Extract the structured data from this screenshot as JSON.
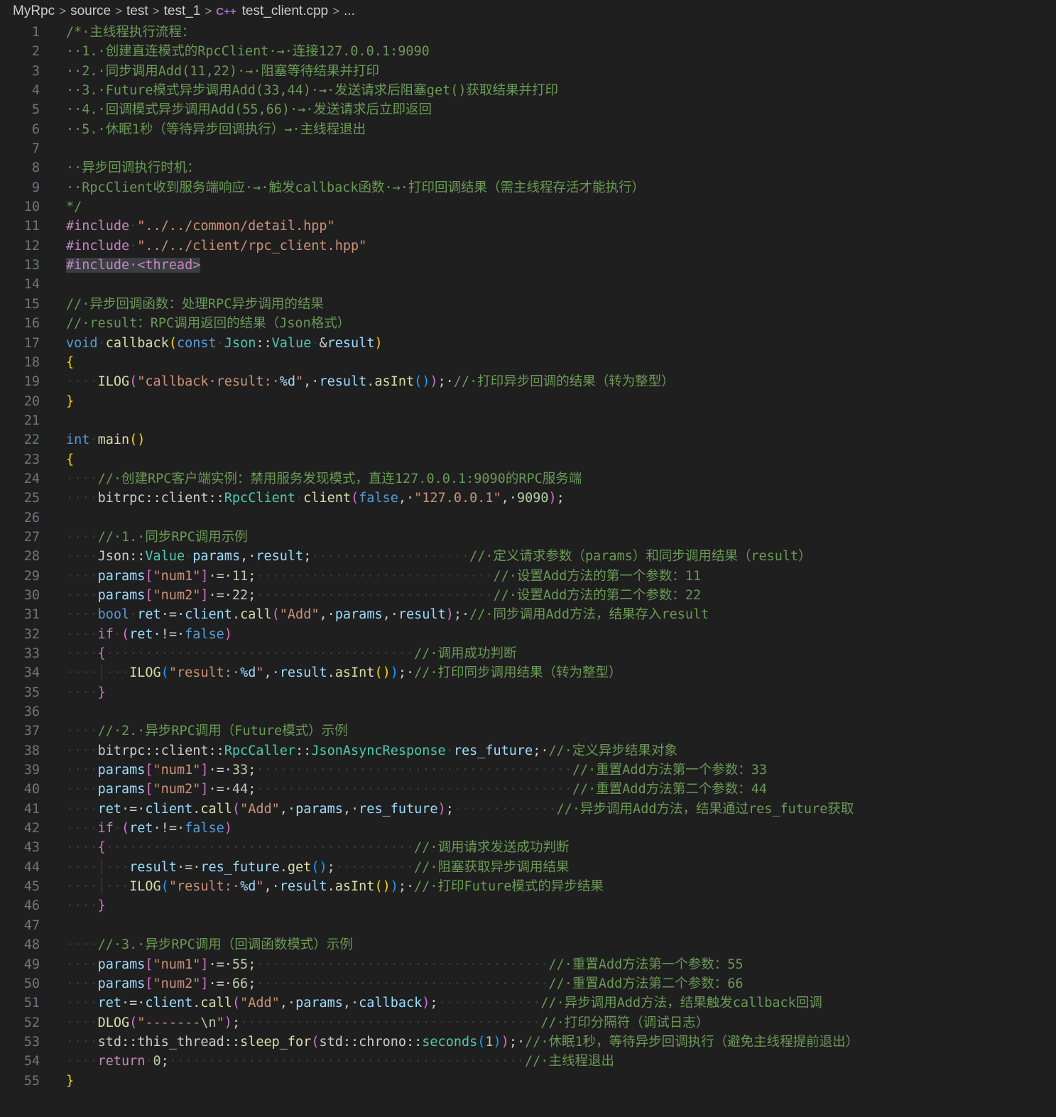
{
  "breadcrumb": {
    "items": [
      "MyRpc",
      "source",
      "test",
      "test_1"
    ],
    "file_icon": "C++",
    "file": "test_client.cpp",
    "ellipsis": "..."
  },
  "code_lines": [
    [
      [
        "/*·主线程执行流程：",
        "cmt"
      ]
    ],
    [
      [
        "··1.·创建直连模式的RpcClient·→·连接127.0.0.1:9090",
        "cmt"
      ]
    ],
    [
      [
        "··2.·同步调用Add(11,22)·→·阻塞等待结果并打印",
        "cmt"
      ]
    ],
    [
      [
        "··3.·Future模式异步调用Add(33,44)·→·发送请求后阻塞get()获取结果并打印",
        "cmt"
      ]
    ],
    [
      [
        "··4.·回调模式异步调用Add(55,66)·→·发送请求后立即返回",
        "cmt"
      ]
    ],
    [
      [
        "··5.·休眠1秒（等待异步回调执行）→·主线程退出",
        "cmt"
      ]
    ],
    [],
    [
      [
        "··异步回调执行时机：",
        "cmt"
      ]
    ],
    [
      [
        "··RpcClient收到服务端响应·→·触发callback函数·→·打印回调结果（需主线程存活才能执行）",
        "cmt"
      ]
    ],
    [
      [
        "*/",
        "cmt"
      ]
    ],
    [
      [
        "#include",
        "ctl"
      ],
      [
        "·",
        "ws"
      ],
      [
        "\"../../common/detail.hpp\"",
        "str"
      ]
    ],
    [
      [
        "#include",
        "ctl"
      ],
      [
        "·",
        "ws"
      ],
      [
        "\"../../client/rpc_client.hpp\"",
        "str"
      ]
    ],
    [
      [
        "#include·<thread>",
        "hl-str"
      ]
    ],
    [],
    [
      [
        "//·异步回调函数：处理RPC异步调用的结果",
        "cmt"
      ]
    ],
    [
      [
        "//·result：RPC调用返回的结果（Json格式）",
        "cmt"
      ]
    ],
    [
      [
        "void",
        "kw"
      ],
      [
        "·",
        "ws"
      ],
      [
        "callback",
        "fn"
      ],
      [
        "(",
        "br1"
      ],
      [
        "const",
        "kw"
      ],
      [
        "·",
        "ws"
      ],
      [
        "Json",
        "ty"
      ],
      [
        "::",
        "plain"
      ],
      [
        "Value",
        "ty"
      ],
      [
        "·",
        "ws"
      ],
      [
        "&",
        "plain"
      ],
      [
        "result",
        "var"
      ],
      [
        ")",
        "br1"
      ]
    ],
    [
      [
        "{",
        "br1"
      ]
    ],
    [
      [
        "····",
        "ws"
      ],
      [
        "ILOG",
        "fn"
      ],
      [
        "(",
        "br2"
      ],
      [
        "\"callback·result:·",
        "str"
      ],
      [
        "%d",
        "var"
      ],
      [
        "\"",
        "str"
      ],
      [
        ",·",
        "plain"
      ],
      [
        "result",
        "var"
      ],
      [
        ".",
        "plain"
      ],
      [
        "asInt",
        "fn"
      ],
      [
        "()",
        "br3"
      ],
      [
        ")",
        "br2"
      ],
      [
        ";·",
        "plain"
      ],
      [
        "//·打印异步回调的结果（转为整型）",
        "cmt"
      ]
    ],
    [
      [
        "}",
        "br1"
      ]
    ],
    [],
    [
      [
        "int",
        "kw"
      ],
      [
        "·",
        "ws"
      ],
      [
        "main",
        "fn"
      ],
      [
        "()",
        "br1"
      ]
    ],
    [
      [
        "{",
        "br1"
      ]
    ],
    [
      [
        "····",
        "ws"
      ],
      [
        "//·创建RPC客户端实例：禁用服务发现模式，直连127.0.0.1:9090的RPC服务端",
        "cmt"
      ]
    ],
    [
      [
        "····",
        "ws"
      ],
      [
        "bitrpc",
        "plain"
      ],
      [
        "::",
        "plain"
      ],
      [
        "client",
        "plain"
      ],
      [
        "::",
        "plain"
      ],
      [
        "RpcClient",
        "ty"
      ],
      [
        "·",
        "ws"
      ],
      [
        "client",
        "fn"
      ],
      [
        "(",
        "br2"
      ],
      [
        "false",
        "kw"
      ],
      [
        ",·",
        "plain"
      ],
      [
        "\"127.0.0.1\"",
        "str"
      ],
      [
        ",·",
        "plain"
      ],
      [
        "9090",
        "num"
      ],
      [
        ")",
        "br2"
      ],
      [
        ";",
        "plain"
      ]
    ],
    [],
    [
      [
        "····",
        "ws"
      ],
      [
        "//·1.·同步RPC调用示例",
        "cmt"
      ]
    ],
    [
      [
        "····",
        "ws"
      ],
      [
        "Json",
        "plain"
      ],
      [
        "::",
        "plain"
      ],
      [
        "Value",
        "ty"
      ],
      [
        "·",
        "ws"
      ],
      [
        "params",
        "var"
      ],
      [
        ",·",
        "plain"
      ],
      [
        "result",
        "var"
      ],
      [
        ";",
        "plain"
      ],
      [
        "····················",
        "ws"
      ],
      [
        "//·定义请求参数（params）和同步调用结果（result）",
        "cmt"
      ]
    ],
    [
      [
        "····",
        "ws"
      ],
      [
        "params",
        "var"
      ],
      [
        "[",
        "br2"
      ],
      [
        "\"num1\"",
        "str"
      ],
      [
        "]",
        "br2"
      ],
      [
        "·=·",
        "plain"
      ],
      [
        "11",
        "num"
      ],
      [
        ";",
        "plain"
      ],
      [
        "······························",
        "ws"
      ],
      [
        "//·设置Add方法的第一个参数：11",
        "cmt"
      ]
    ],
    [
      [
        "····",
        "ws"
      ],
      [
        "params",
        "var"
      ],
      [
        "[",
        "br2"
      ],
      [
        "\"num2\"",
        "str"
      ],
      [
        "]",
        "br2"
      ],
      [
        "·=·",
        "plain"
      ],
      [
        "22",
        "num"
      ],
      [
        ";",
        "plain"
      ],
      [
        "······························",
        "ws"
      ],
      [
        "//·设置Add方法的第二个参数：22",
        "cmt"
      ]
    ],
    [
      [
        "····",
        "ws"
      ],
      [
        "bool",
        "kw"
      ],
      [
        "·",
        "ws"
      ],
      [
        "ret",
        "var"
      ],
      [
        "·=·",
        "plain"
      ],
      [
        "client",
        "var"
      ],
      [
        ".",
        "plain"
      ],
      [
        "call",
        "fn"
      ],
      [
        "(",
        "br2"
      ],
      [
        "\"Add\"",
        "str"
      ],
      [
        ",·",
        "plain"
      ],
      [
        "params",
        "var"
      ],
      [
        ",·",
        "plain"
      ],
      [
        "result",
        "var"
      ],
      [
        ")",
        "br2"
      ],
      [
        ";·",
        "plain"
      ],
      [
        "//·同步调用Add方法，结果存入result",
        "cmt"
      ]
    ],
    [
      [
        "····",
        "ws"
      ],
      [
        "if",
        "ctl"
      ],
      [
        "·",
        "ws"
      ],
      [
        "(",
        "br2"
      ],
      [
        "ret",
        "var"
      ],
      [
        "·!=·",
        "plain"
      ],
      [
        "false",
        "kw"
      ],
      [
        ")",
        "br2"
      ]
    ],
    [
      [
        "····",
        "ws"
      ],
      [
        "{",
        "br2"
      ],
      [
        "·······································",
        "ws"
      ],
      [
        "//·调用成功判断",
        "cmt"
      ]
    ],
    [
      [
        "····│···",
        "ws"
      ],
      [
        "ILOG",
        "fn"
      ],
      [
        "(",
        "br3"
      ],
      [
        "\"result:·",
        "str"
      ],
      [
        "%d",
        "var"
      ],
      [
        "\"",
        "str"
      ],
      [
        ",·",
        "plain"
      ],
      [
        "result",
        "var"
      ],
      [
        ".",
        "plain"
      ],
      [
        "asInt",
        "fn"
      ],
      [
        "(",
        "br1"
      ],
      [
        ")",
        "br1"
      ],
      [
        ")",
        "br3"
      ],
      [
        ";·",
        "plain"
      ],
      [
        "//·打印同步调用结果（转为整型）",
        "cmt"
      ]
    ],
    [
      [
        "····",
        "ws"
      ],
      [
        "}",
        "br2"
      ]
    ],
    [],
    [
      [
        "····",
        "ws"
      ],
      [
        "//·2.·异步RPC调用（Future模式）示例",
        "cmt"
      ]
    ],
    [
      [
        "····",
        "ws"
      ],
      [
        "bitrpc",
        "plain"
      ],
      [
        "::",
        "plain"
      ],
      [
        "client",
        "plain"
      ],
      [
        "::",
        "plain"
      ],
      [
        "RpcCaller",
        "ty"
      ],
      [
        "::",
        "plain"
      ],
      [
        "JsonAsyncResponse",
        "ty"
      ],
      [
        "·",
        "ws"
      ],
      [
        "res_future",
        "var"
      ],
      [
        ";·",
        "plain"
      ],
      [
        "//·定义异步结果对象",
        "cmt"
      ]
    ],
    [
      [
        "····",
        "ws"
      ],
      [
        "params",
        "var"
      ],
      [
        "[",
        "br2"
      ],
      [
        "\"num1\"",
        "str"
      ],
      [
        "]",
        "br2"
      ],
      [
        "·=·",
        "plain"
      ],
      [
        "33",
        "num"
      ],
      [
        ";",
        "plain"
      ],
      [
        "········································",
        "ws"
      ],
      [
        "//·重置Add方法第一个参数：33",
        "cmt"
      ]
    ],
    [
      [
        "····",
        "ws"
      ],
      [
        "params",
        "var"
      ],
      [
        "[",
        "br2"
      ],
      [
        "\"num2\"",
        "str"
      ],
      [
        "]",
        "br2"
      ],
      [
        "·=·",
        "plain"
      ],
      [
        "44",
        "num"
      ],
      [
        ";",
        "plain"
      ],
      [
        "········································",
        "ws"
      ],
      [
        "//·重置Add方法第二个参数：44",
        "cmt"
      ]
    ],
    [
      [
        "····",
        "ws"
      ],
      [
        "ret",
        "var"
      ],
      [
        "·=·",
        "plain"
      ],
      [
        "client",
        "var"
      ],
      [
        ".",
        "plain"
      ],
      [
        "call",
        "fn"
      ],
      [
        "(",
        "br2"
      ],
      [
        "\"Add\"",
        "str"
      ],
      [
        ",·",
        "plain"
      ],
      [
        "params",
        "var"
      ],
      [
        ",·",
        "plain"
      ],
      [
        "res_future",
        "var"
      ],
      [
        ")",
        "br2"
      ],
      [
        ";",
        "plain"
      ],
      [
        "·············",
        "ws"
      ],
      [
        "//·异步调用Add方法，结果通过res_future获取",
        "cmt"
      ]
    ],
    [
      [
        "····",
        "ws"
      ],
      [
        "if",
        "ctl"
      ],
      [
        "·",
        "ws"
      ],
      [
        "(",
        "br2"
      ],
      [
        "ret",
        "var"
      ],
      [
        "·!=·",
        "plain"
      ],
      [
        "false",
        "kw"
      ],
      [
        ")",
        "br2"
      ]
    ],
    [
      [
        "····",
        "ws"
      ],
      [
        "{",
        "br2"
      ],
      [
        "·······································",
        "ws"
      ],
      [
        "//·调用请求发送成功判断",
        "cmt"
      ]
    ],
    [
      [
        "····│···",
        "ws"
      ],
      [
        "result",
        "var"
      ],
      [
        "·=·",
        "plain"
      ],
      [
        "res_future",
        "var"
      ],
      [
        ".",
        "plain"
      ],
      [
        "get",
        "fn"
      ],
      [
        "()",
        "br3"
      ],
      [
        ";",
        "plain"
      ],
      [
        "··········",
        "ws"
      ],
      [
        "//·阻塞获取异步调用结果",
        "cmt"
      ]
    ],
    [
      [
        "····│···",
        "ws"
      ],
      [
        "ILOG",
        "fn"
      ],
      [
        "(",
        "br3"
      ],
      [
        "\"result:·",
        "str"
      ],
      [
        "%d",
        "var"
      ],
      [
        "\"",
        "str"
      ],
      [
        ",·",
        "plain"
      ],
      [
        "result",
        "var"
      ],
      [
        ".",
        "plain"
      ],
      [
        "asInt",
        "fn"
      ],
      [
        "(",
        "br1"
      ],
      [
        ")",
        "br1"
      ],
      [
        ")",
        "br3"
      ],
      [
        ";·",
        "plain"
      ],
      [
        "//·打印Future模式的异步结果",
        "cmt"
      ]
    ],
    [
      [
        "····",
        "ws"
      ],
      [
        "}",
        "br2"
      ]
    ],
    [],
    [
      [
        "····",
        "ws"
      ],
      [
        "//·3.·异步RPC调用（回调函数模式）示例",
        "cmt"
      ]
    ],
    [
      [
        "····",
        "ws"
      ],
      [
        "params",
        "var"
      ],
      [
        "[",
        "br2"
      ],
      [
        "\"num1\"",
        "str"
      ],
      [
        "]",
        "br2"
      ],
      [
        "·=·",
        "plain"
      ],
      [
        "55",
        "num"
      ],
      [
        ";",
        "plain"
      ],
      [
        "·····································",
        "ws"
      ],
      [
        "//·重置Add方法第一个参数：55",
        "cmt"
      ]
    ],
    [
      [
        "····",
        "ws"
      ],
      [
        "params",
        "var"
      ],
      [
        "[",
        "br2"
      ],
      [
        "\"num2\"",
        "str"
      ],
      [
        "]",
        "br2"
      ],
      [
        "·=·",
        "plain"
      ],
      [
        "66",
        "num"
      ],
      [
        ";",
        "plain"
      ],
      [
        "·····································",
        "ws"
      ],
      [
        "//·重置Add方法第二个参数：66",
        "cmt"
      ]
    ],
    [
      [
        "····",
        "ws"
      ],
      [
        "ret",
        "var"
      ],
      [
        "·=·",
        "plain"
      ],
      [
        "client",
        "var"
      ],
      [
        ".",
        "plain"
      ],
      [
        "call",
        "fn"
      ],
      [
        "(",
        "br2"
      ],
      [
        "\"Add\"",
        "str"
      ],
      [
        ",·",
        "plain"
      ],
      [
        "params",
        "var"
      ],
      [
        ",·",
        "plain"
      ],
      [
        "callback",
        "var"
      ],
      [
        ")",
        "br2"
      ],
      [
        ";",
        "plain"
      ],
      [
        "·············",
        "ws"
      ],
      [
        "//·异步调用Add方法，结果触发callback回调",
        "cmt"
      ]
    ],
    [
      [
        "····",
        "ws"
      ],
      [
        "DLOG",
        "fn"
      ],
      [
        "(",
        "br2"
      ],
      [
        "\"-------",
        "str"
      ],
      [
        "\\n",
        "num"
      ],
      [
        "\"",
        "str"
      ],
      [
        ")",
        "br2"
      ],
      [
        ";",
        "plain"
      ],
      [
        "······································",
        "ws"
      ],
      [
        "//·打印分隔符（调试日志）",
        "cmt"
      ]
    ],
    [
      [
        "····",
        "ws"
      ],
      [
        "std",
        "plain"
      ],
      [
        "::",
        "plain"
      ],
      [
        "this_thread",
        "plain"
      ],
      [
        "::",
        "plain"
      ],
      [
        "sleep_for",
        "fn"
      ],
      [
        "(",
        "br2"
      ],
      [
        "std",
        "plain"
      ],
      [
        "::",
        "plain"
      ],
      [
        "chrono",
        "plain"
      ],
      [
        "::",
        "plain"
      ],
      [
        "seconds",
        "ty"
      ],
      [
        "(",
        "br3"
      ],
      [
        "1",
        "num"
      ],
      [
        ")",
        "br3"
      ],
      [
        ")",
        "br2"
      ],
      [
        ";·",
        "plain"
      ],
      [
        "//·休眠1秒，等待异步回调执行（避免主线程提前退出）",
        "cmt"
      ]
    ],
    [
      [
        "····",
        "ws"
      ],
      [
        "return",
        "ctl"
      ],
      [
        "·",
        "ws"
      ],
      [
        "0",
        "num"
      ],
      [
        ";",
        "plain"
      ],
      [
        "·············································",
        "ws"
      ],
      [
        "//·主线程退出",
        "cmt"
      ]
    ],
    [
      [
        "}",
        "br1"
      ]
    ]
  ]
}
